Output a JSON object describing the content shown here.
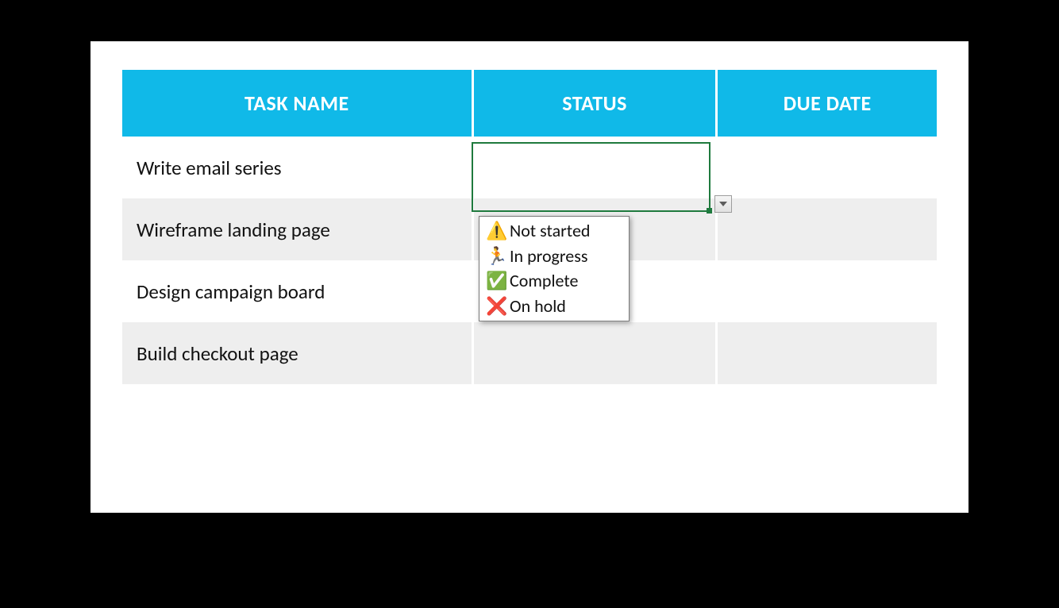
{
  "headers": {
    "task": "TASK NAME",
    "status": "STATUS",
    "due": "DUE DATE"
  },
  "rows": [
    {
      "task": "Write email series",
      "status": "",
      "due": ""
    },
    {
      "task": "Wireframe landing page",
      "status": "",
      "due": ""
    },
    {
      "task": "Design campaign board",
      "status": "",
      "due": ""
    },
    {
      "task": "Build checkout page",
      "status": "",
      "due": ""
    }
  ],
  "dropdown": {
    "options": [
      {
        "emoji": "⚠️",
        "label": "Not started"
      },
      {
        "emoji": "🏃",
        "label": "In progress"
      },
      {
        "emoji": "✅",
        "label": "Complete"
      },
      {
        "emoji": "❌",
        "label": "On hold"
      }
    ]
  }
}
